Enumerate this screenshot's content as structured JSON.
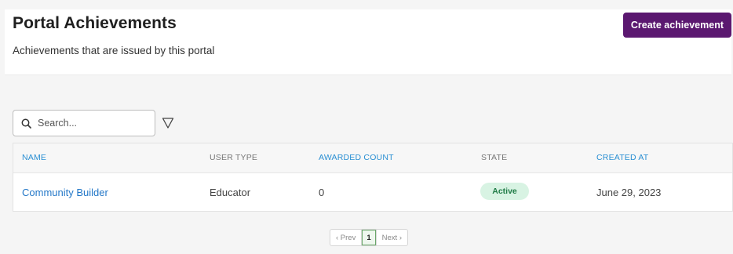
{
  "header": {
    "title": "Portal Achievements",
    "subtitle": "Achievements that are issued by this portal",
    "create_button": "Create achievement"
  },
  "search": {
    "placeholder": "Search..."
  },
  "icons": {
    "search": "search-icon",
    "filter": "filter-icon"
  },
  "table": {
    "columns": [
      "NAME",
      "USER TYPE",
      "AWARDED COUNT",
      "STATE",
      "CREATED AT"
    ],
    "rows": [
      {
        "name": "Community Builder",
        "user_type": "Educator",
        "awarded_count": "0",
        "state": "Active",
        "created_at": "June 29, 2023"
      }
    ]
  },
  "pagination": {
    "prev": "‹ Prev",
    "current": "1",
    "next": "Next ›"
  },
  "colors": {
    "brand": "#5b1870",
    "link": "#2a8fd3",
    "active_badge_bg": "#d8f3e3",
    "active_badge_text": "#1e7a45"
  }
}
